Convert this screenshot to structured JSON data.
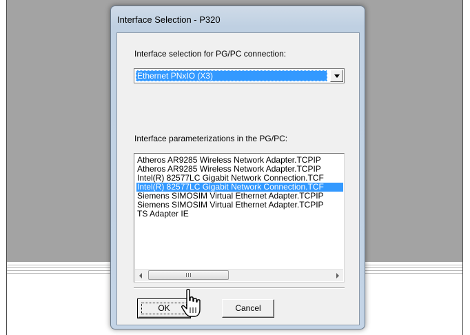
{
  "dialog": {
    "title": "Interface Selection - P320",
    "selection_label": "Interface selection for PG/PC connection:",
    "selected_interface": "Ethernet PNxIO (X3)",
    "param_label": "Interface parameterizations in the PG/PC:",
    "param_items": [
      "Atheros AR9285 Wireless Network Adapter.TCPIP",
      "Atheros AR9285 Wireless Network Adapter.TCPIP",
      "Intel(R) 82577LC Gigabit Network Connection.TCF",
      "Intel(R) 82577LC Gigabit Network Connection.TCF",
      "Siemens SIMOSIM Virtual Ethernet Adapter.TCPIP",
      "Siemens SIMOSIM Virtual Ethernet Adapter.TCPIP",
      "TS Adapter IE"
    ],
    "selected_item_index": 3,
    "ok_label": "OK",
    "cancel_label": "Cancel"
  },
  "icons": {
    "dropdown": "chevron-down-icon",
    "scroll_left": "arrow-left-icon",
    "scroll_right": "arrow-right-icon",
    "cursor": "hand-pointer-icon"
  },
  "colors": {
    "selection": "#3399ff",
    "dialog_frame": "#c4d4e6",
    "client": "#f0f0f0"
  }
}
